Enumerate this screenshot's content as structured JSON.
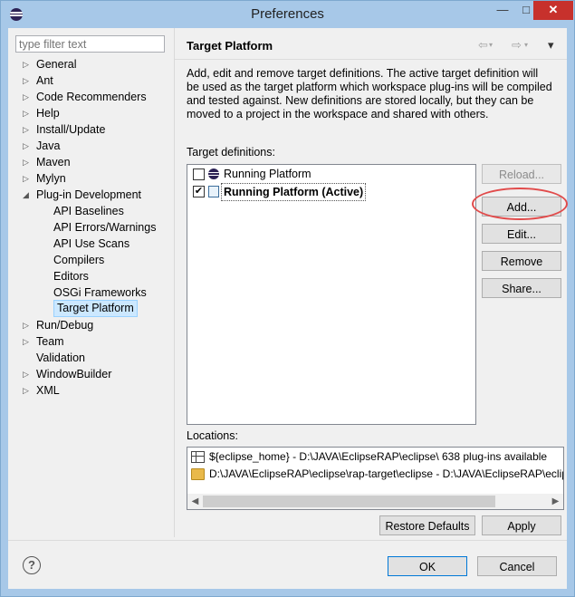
{
  "window": {
    "title": "Preferences",
    "minimize_glyph": "—",
    "maximize_glyph": "□",
    "close_glyph": "✕"
  },
  "filter": {
    "placeholder": "type filter text",
    "value": ""
  },
  "tree": {
    "items": [
      {
        "label": "General",
        "expandable": true
      },
      {
        "label": "Ant",
        "expandable": true
      },
      {
        "label": "Code Recommenders",
        "expandable": true
      },
      {
        "label": "Help",
        "expandable": true
      },
      {
        "label": "Install/Update",
        "expandable": true
      },
      {
        "label": "Java",
        "expandable": true
      },
      {
        "label": "Maven",
        "expandable": true
      },
      {
        "label": "Mylyn",
        "expandable": true
      },
      {
        "label": "Plug-in Development",
        "expandable": true,
        "expanded": true
      },
      {
        "label": "API Baselines",
        "child": true
      },
      {
        "label": "API Errors/Warnings",
        "child": true
      },
      {
        "label": "API Use Scans",
        "child": true
      },
      {
        "label": "Compilers",
        "child": true
      },
      {
        "label": "Editors",
        "child": true
      },
      {
        "label": "OSGi Frameworks",
        "child": true
      },
      {
        "label": "Target Platform",
        "child": true,
        "selected": true
      },
      {
        "label": "Run/Debug",
        "expandable": true
      },
      {
        "label": "Team",
        "expandable": true
      },
      {
        "label": "Validation"
      },
      {
        "label": "WindowBuilder",
        "expandable": true
      },
      {
        "label": "XML",
        "expandable": true
      }
    ]
  },
  "page": {
    "title": "Target Platform",
    "nav": {
      "back": "⇦",
      "forward": "⇨",
      "menu": "▾"
    },
    "description": "Add, edit and remove target definitions.  The active target definition will be used as the target platform which workspace plug-ins will be compiled and tested against.  New definitions are stored locally, but they can be moved to a project in the workspace and shared with others.",
    "target_label": "Target definitions:",
    "targets": [
      {
        "name": "Running Platform",
        "checked": false,
        "check_glyph": "",
        "icon": "eclipse-icon",
        "active": false
      },
      {
        "name": "Running Platform (Active)",
        "checked": true,
        "check_glyph": "✔",
        "icon": "target-definition-icon",
        "active": true
      }
    ],
    "buttons": {
      "reload": "Reload...",
      "add": "Add...",
      "edit": "Edit...",
      "remove": "Remove",
      "share": "Share..."
    },
    "locations_label": "Locations:",
    "locations": [
      {
        "text": "${eclipse_home} - D:\\JAVA\\EclipseRAP\\eclipse\\ 638 plug-ins available",
        "icon": "installation-icon"
      },
      {
        "text": "D:\\JAVA\\EclipseRAP\\eclipse\\rap-target\\eclipse - D:\\JAVA\\EclipseRAP\\eclipse\\rap-target\\eclipse",
        "icon": "folder-icon"
      }
    ],
    "scroll": {
      "left": "◀",
      "right": "▶"
    },
    "restore_defaults": "Restore Defaults",
    "apply": "Apply"
  },
  "footer": {
    "help_glyph": "?",
    "ok": "OK",
    "cancel": "Cancel"
  }
}
